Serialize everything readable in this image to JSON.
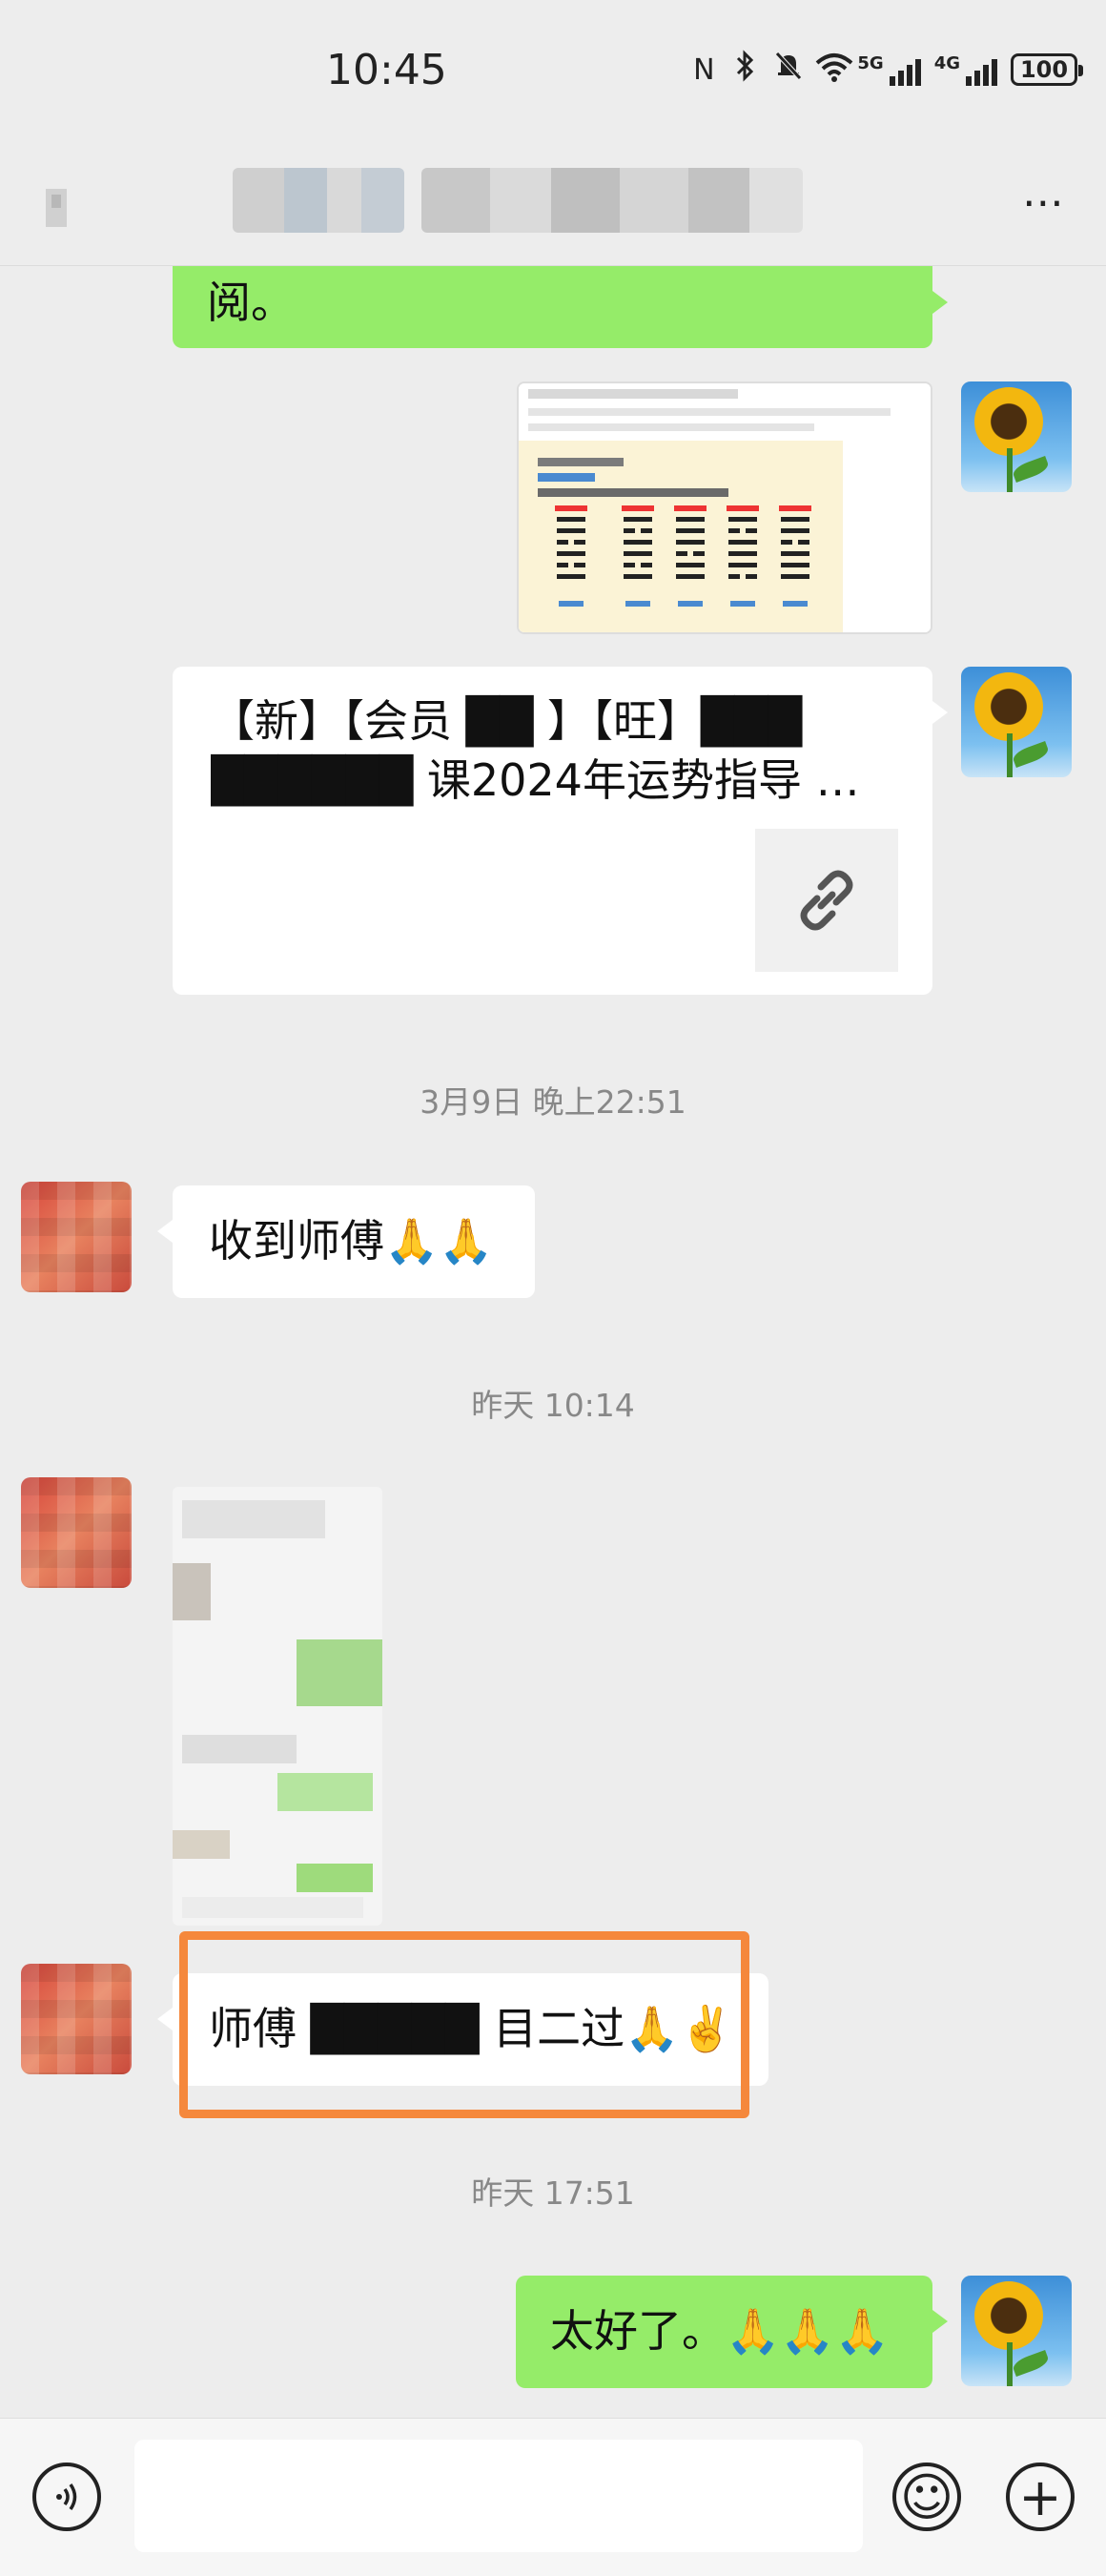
{
  "status_bar": {
    "time": "10:45",
    "signal_1_label": "5G",
    "signal_2_label": "4G",
    "battery": "100"
  },
  "title_bar": {
    "more_label": "⋯"
  },
  "messages": {
    "m1_text": "阅。",
    "card_line1": "【新】【会员 ██ 】【旺】███",
    "card_line2": "██████ 课2024年运势指导 …",
    "ts1": "3月9日 晚上22:51",
    "m_received": "收到师傅🙏🙏",
    "ts2": "昨天 10:14",
    "m_highlight": "师傅 █████ 目二过🙏✌️",
    "ts3": "昨天 17:51",
    "m_last": "太好了。🙏🙏🙏"
  },
  "input_bar": {
    "emoji_label": "☺",
    "plus_label": "+"
  },
  "colors": {
    "my_bubble": "#95ec69",
    "other_bubble": "#ffffff",
    "background": "#ededed",
    "highlight": "#f5883c"
  }
}
